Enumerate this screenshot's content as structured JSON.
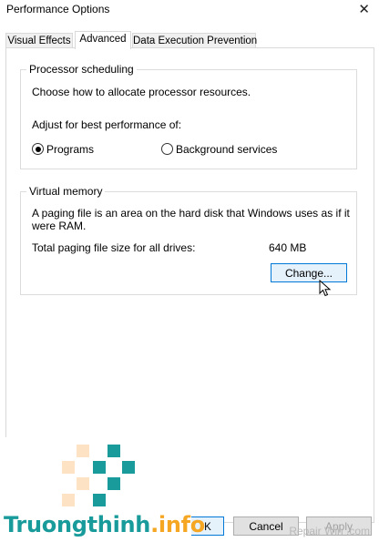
{
  "window": {
    "title": "Performance Options",
    "close_glyph": "✕"
  },
  "tabs": [
    {
      "label": "Visual Effects",
      "active": false
    },
    {
      "label": "Advanced",
      "active": true
    },
    {
      "label": "Data Execution Prevention",
      "active": false
    }
  ],
  "processor": {
    "group_label": "Processor scheduling",
    "description": "Choose how to allocate processor resources.",
    "adjust_label": "Adjust for best performance of:",
    "options": [
      {
        "label": "Programs",
        "selected": true
      },
      {
        "label": "Background services",
        "selected": false
      }
    ]
  },
  "virtual_memory": {
    "group_label": "Virtual memory",
    "description": "A paging file is an area on the hard disk that Windows uses as if it were RAM.",
    "total_label": "Total paging file size for all drives:",
    "total_value": "640 MB",
    "change_button": "Change..."
  },
  "footer": {
    "ok_button": "K",
    "cancel_button": "Cancel",
    "apply_button": "Apply"
  },
  "watermark": {
    "brand_text_1": "Truongthinh",
    "brand_text_2": ".info",
    "brand_color": "#1a9b9b",
    "brand_accent": "#f5a623",
    "corner_text": "Repair Win .com"
  }
}
